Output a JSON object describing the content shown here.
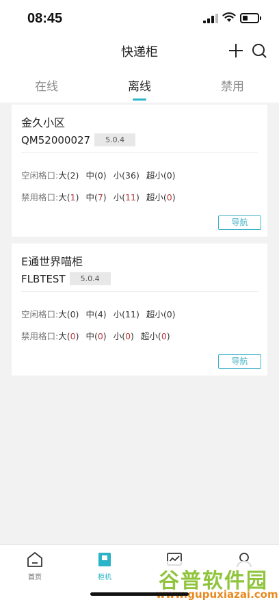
{
  "status_bar": {
    "time": "08:45"
  },
  "header": {
    "title": "快递柜",
    "add_icon": "plus-icon",
    "search_icon": "search-icon"
  },
  "tabs": [
    {
      "label": "在线",
      "active": false
    },
    {
      "label": "离线",
      "active": true
    },
    {
      "label": "禁用",
      "active": false
    }
  ],
  "accent_color": "#2bb3c7",
  "cabinets": [
    {
      "name": "金久小区",
      "code": "QM52000027",
      "version": "5.0.4",
      "free_label": "空闲格口:",
      "free": [
        "大(2)",
        "中(0)",
        "小(36)",
        "超小(0)"
      ],
      "disabled_label": "禁用格口:",
      "disabled": [
        {
          "pre": "大(",
          "num": "1",
          "post": ")"
        },
        {
          "pre": "中(",
          "num": "7",
          "post": ")"
        },
        {
          "pre": "小(",
          "num": "11",
          "post": ")"
        },
        {
          "pre": "超小(",
          "num": "0",
          "post": ")"
        }
      ],
      "nav_label": "导航"
    },
    {
      "name": "E通世界喵柜",
      "code": "FLBTEST",
      "version": "5.0.4",
      "free_label": "空闲格口:",
      "free": [
        "大(0)",
        "中(4)",
        "小(11)",
        "超小(0)"
      ],
      "disabled_label": "禁用格口:",
      "disabled": [
        {
          "pre": "大(",
          "num": "0",
          "post": ")"
        },
        {
          "pre": "中(",
          "num": "0",
          "post": ")"
        },
        {
          "pre": "小(",
          "num": "0",
          "post": ")"
        },
        {
          "pre": "超小(",
          "num": "0",
          "post": ")"
        }
      ],
      "nav_label": "导航"
    }
  ],
  "bottom_nav": [
    {
      "label": "首页",
      "icon": "home-icon",
      "active": false
    },
    {
      "label": "柜机",
      "icon": "cabinet-icon",
      "active": true
    },
    {
      "label": "",
      "icon": "chart-icon",
      "active": false
    },
    {
      "label": "",
      "icon": "user-icon",
      "active": false
    }
  ],
  "watermark": {
    "text": "谷普软件园",
    "url": "www.gupuxiazai.com"
  }
}
